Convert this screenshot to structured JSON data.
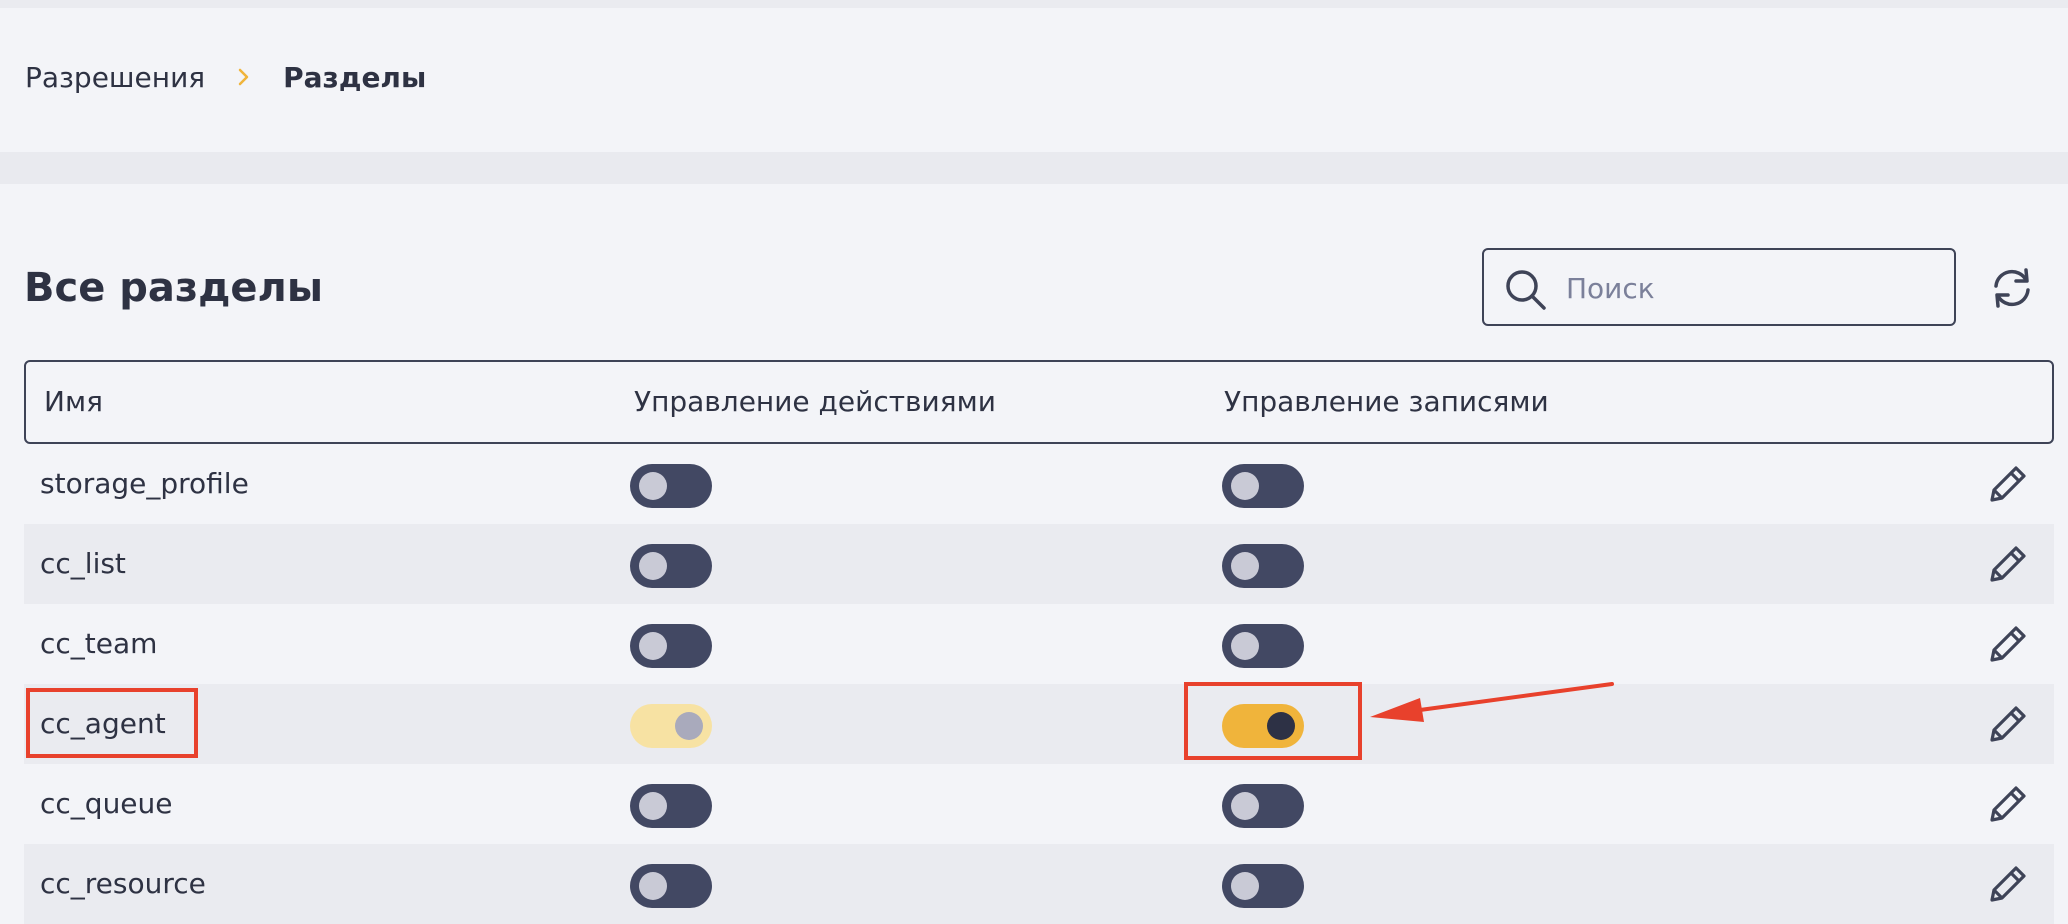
{
  "breadcrumb": {
    "items": [
      "Разрешения",
      "Разделы"
    ]
  },
  "page": {
    "title": "Все разделы"
  },
  "search": {
    "placeholder": "Поиск",
    "value": ""
  },
  "table": {
    "columns": [
      "Имя",
      "Управление действиями",
      "Управление записями"
    ],
    "rows": [
      {
        "name": "storage_profile",
        "actions": "off",
        "records": "off"
      },
      {
        "name": "cc_list",
        "actions": "off",
        "records": "off"
      },
      {
        "name": "cc_team",
        "actions": "off",
        "records": "off"
      },
      {
        "name": "cc_agent",
        "actions": "on-disabled",
        "records": "on"
      },
      {
        "name": "cc_queue",
        "actions": "off",
        "records": "off"
      },
      {
        "name": "cc_resource",
        "actions": "off",
        "records": "off"
      }
    ]
  },
  "icons": {
    "breadcrumb_separator": "chevron-right-icon",
    "search": "search-icon",
    "refresh": "refresh-icon",
    "row_action": "pencil-icon"
  },
  "colors": {
    "accent": "#f0b43b",
    "toggle_off": "#424863",
    "annotation": "#e8412c"
  }
}
